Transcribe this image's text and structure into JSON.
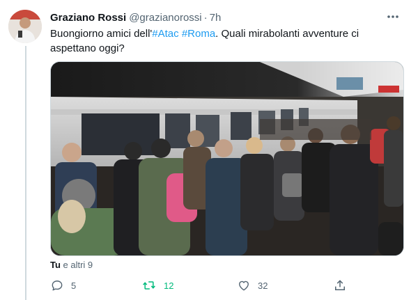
{
  "tweet": {
    "author_name": "Graziano Rossi",
    "author_handle": "@grazianorossi",
    "separator": "·",
    "time": "7h",
    "text_part1": "Buongiorno amici dell'",
    "hashtag1": "#Atac",
    "hashtag2": "#Roma",
    "text_part2": ". Quali mirabolanti avventure ci aspettano oggi?",
    "liked_by_bold": "Tu",
    "liked_by_rest": " e altri 9"
  },
  "actions": {
    "replies": "5",
    "retweets": "12",
    "likes": "32"
  },
  "icons": {
    "more": "more-icon",
    "reply": "reply-icon",
    "retweet": "retweet-icon",
    "like": "heart-icon",
    "share": "share-icon"
  },
  "colors": {
    "hashtag": "#1d9bf0",
    "retweet_active": "#00ba7c",
    "muted": "#536471"
  }
}
